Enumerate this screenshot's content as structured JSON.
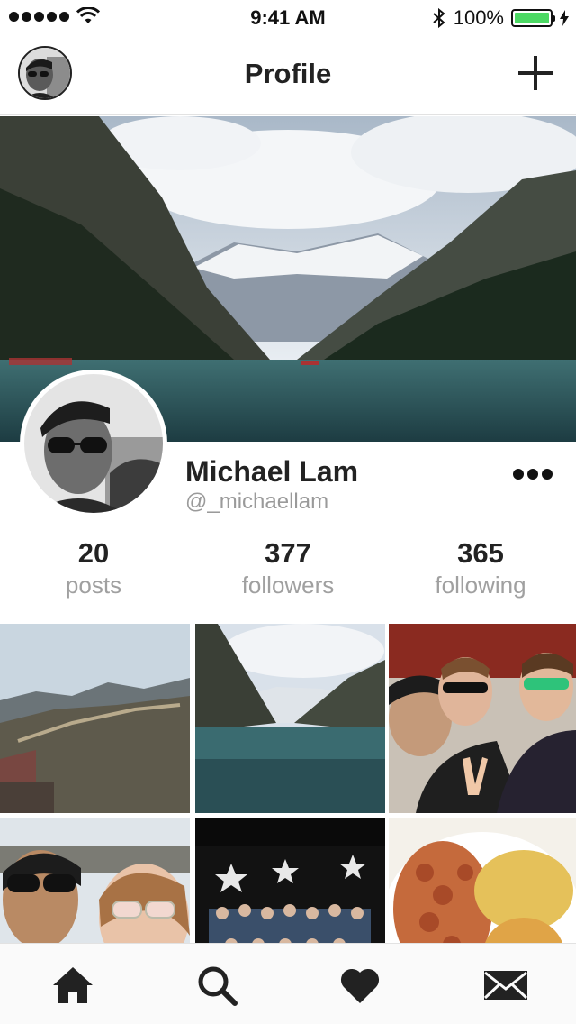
{
  "status_bar": {
    "time": "9:41 AM",
    "battery": "100%",
    "battery_level": 1.0
  },
  "nav": {
    "title": "Profile"
  },
  "profile": {
    "name": "Michael Lam",
    "handle": "@_michaellam"
  },
  "stats": [
    {
      "value": "20",
      "label": "posts"
    },
    {
      "value": "377",
      "label": "followers"
    },
    {
      "value": "365",
      "label": "following"
    }
  ],
  "colors": {
    "battery": "#4cd964",
    "text": "#222222",
    "muted": "#9a9a9a"
  },
  "icons": {
    "nav_add": "plus-icon",
    "more": "more-icon",
    "tabs": [
      "home-icon",
      "search-icon",
      "heart-icon",
      "mail-icon"
    ]
  }
}
